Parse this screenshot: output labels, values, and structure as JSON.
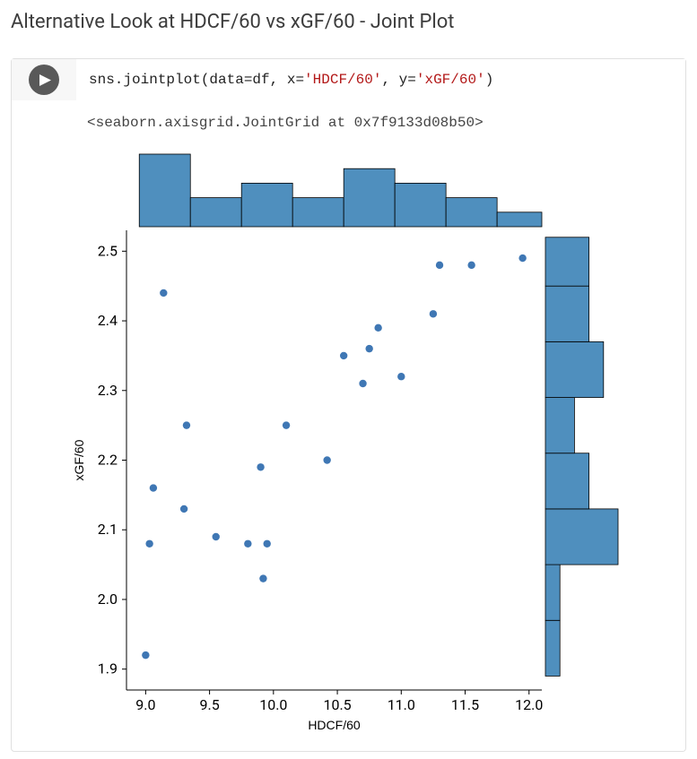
{
  "section_title": "Alternative Look at HDCF/60 vs xGF/60 - Joint Plot",
  "code": {
    "prefix": "sns.jointplot(data=df, x=",
    "arg1": "'HDCF/60'",
    "mid": ", y=",
    "arg2": "'xGF/60'",
    "suffix": ")"
  },
  "output_repr": "<seaborn.axisgrid.JointGrid at 0x7f9133d08b50>",
  "chart_data": {
    "type": "scatter_with_marginals",
    "xlabel": "HDCF/60",
    "ylabel": "xGF/60",
    "xlim": [
      8.85,
      12.1
    ],
    "ylim": [
      1.87,
      2.53
    ],
    "xticks": [
      9.0,
      9.5,
      10.0,
      10.5,
      11.0,
      11.5,
      12.0
    ],
    "yticks": [
      1.9,
      2.0,
      2.1,
      2.2,
      2.3,
      2.4,
      2.5
    ],
    "points": [
      {
        "x": 9.0,
        "y": 1.92
      },
      {
        "x": 9.03,
        "y": 2.08
      },
      {
        "x": 9.06,
        "y": 2.16
      },
      {
        "x": 9.14,
        "y": 2.44
      },
      {
        "x": 9.3,
        "y": 2.13
      },
      {
        "x": 9.32,
        "y": 2.25
      },
      {
        "x": 9.55,
        "y": 2.09
      },
      {
        "x": 9.8,
        "y": 2.08
      },
      {
        "x": 9.9,
        "y": 2.19
      },
      {
        "x": 9.92,
        "y": 2.03
      },
      {
        "x": 9.95,
        "y": 2.08
      },
      {
        "x": 10.1,
        "y": 2.25
      },
      {
        "x": 10.42,
        "y": 2.2
      },
      {
        "x": 10.55,
        "y": 2.35
      },
      {
        "x": 10.7,
        "y": 2.31
      },
      {
        "x": 10.75,
        "y": 2.36
      },
      {
        "x": 10.82,
        "y": 2.39
      },
      {
        "x": 11.0,
        "y": 2.32
      },
      {
        "x": 11.25,
        "y": 2.41
      },
      {
        "x": 11.3,
        "y": 2.48
      },
      {
        "x": 11.55,
        "y": 2.48
      },
      {
        "x": 11.95,
        "y": 2.49
      }
    ],
    "top_hist": {
      "bin_edges": [
        8.95,
        9.35,
        9.75,
        10.15,
        10.55,
        10.95,
        11.35,
        11.75,
        12.1
      ],
      "counts": [
        5,
        2,
        3,
        2,
        4,
        3,
        2,
        1
      ]
    },
    "right_hist": {
      "bin_edges": [
        1.89,
        1.97,
        2.05,
        2.13,
        2.21,
        2.29,
        2.37,
        2.45,
        2.52
      ],
      "counts": [
        1,
        1,
        5,
        3,
        2,
        4,
        3,
        3
      ]
    }
  }
}
